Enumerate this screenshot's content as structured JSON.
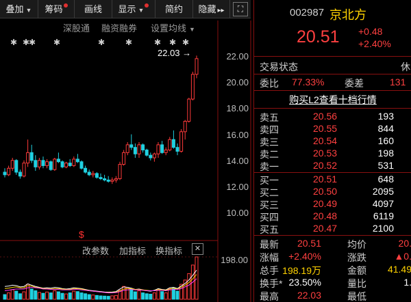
{
  "toolbar": {
    "items": [
      {
        "label": "叠加",
        "caret": true,
        "dot": false
      },
      {
        "label": "筹码",
        "caret": false,
        "dot": true
      },
      {
        "label": "画线",
        "caret": false,
        "dot": false
      },
      {
        "label": "显示",
        "caret": true,
        "dot": true
      },
      {
        "label": "简约",
        "caret": false,
        "dot": false
      },
      {
        "label": "隐藏",
        "caret": false,
        "dot": false,
        "arrow": "▸▸"
      }
    ],
    "expand_icon": "⛶"
  },
  "chart_links": {
    "shengu": "深股通",
    "rongzi": "融资融券",
    "settings": "设置均线"
  },
  "stars": [
    "✱",
    "✱✱",
    "✱",
    "✱",
    "✱",
    "✱",
    "✱",
    "✱"
  ],
  "high_marker": "22.03",
  "y_axis": [
    "22.00",
    "20.00",
    "18.00",
    "16.00",
    "14.00",
    "12.00",
    "10.00"
  ],
  "indicator": {
    "tabs": [
      "改参数",
      "加指标",
      "换指标"
    ],
    "close": "✕",
    "axis_label": "198.00"
  },
  "chart_data": {
    "type": "candlestick",
    "price_axis": {
      "ticks": [
        10,
        12,
        14,
        16,
        18,
        20,
        22
      ]
    },
    "high_annotation": 22.03,
    "volume_axis_label": 198.0,
    "candles": [
      [
        13.1,
        13.4,
        12.7,
        12.9
      ],
      [
        12.9,
        13.6,
        12.8,
        13.4
      ],
      [
        13.4,
        14.2,
        13.2,
        14.0
      ],
      [
        14.0,
        14.1,
        12.9,
        13.1
      ],
      [
        13.1,
        13.3,
        12.6,
        12.8
      ],
      [
        12.8,
        14.0,
        12.7,
        13.8
      ],
      [
        13.8,
        15.6,
        13.5,
        14.6
      ],
      [
        14.6,
        15.2,
        13.8,
        14.0
      ],
      [
        14.0,
        14.4,
        13.2,
        13.5
      ],
      [
        13.5,
        14.2,
        13.3,
        14.0
      ],
      [
        14.0,
        14.3,
        13.4,
        13.6
      ],
      [
        13.6,
        14.1,
        13.4,
        13.9
      ],
      [
        13.9,
        14.0,
        13.2,
        13.3
      ],
      [
        13.3,
        14.2,
        13.2,
        14.1
      ],
      [
        14.1,
        14.6,
        13.8,
        13.9
      ],
      [
        13.9,
        14.0,
        13.4,
        13.5
      ],
      [
        13.5,
        13.9,
        13.4,
        13.8
      ],
      [
        13.8,
        14.1,
        13.5,
        13.6
      ],
      [
        13.6,
        14.3,
        13.5,
        14.1
      ],
      [
        14.1,
        14.5,
        13.8,
        13.9
      ],
      [
        13.9,
        14.0,
        13.3,
        13.4
      ],
      [
        13.4,
        13.6,
        13.0,
        13.1
      ],
      [
        13.1,
        13.3,
        12.8,
        12.9
      ],
      [
        12.9,
        13.2,
        12.7,
        13.0
      ],
      [
        13.0,
        13.1,
        12.6,
        12.7
      ],
      [
        12.7,
        13.0,
        12.5,
        12.6
      ],
      [
        12.6,
        12.9,
        12.4,
        12.5
      ],
      [
        12.5,
        12.8,
        12.3,
        12.4
      ],
      [
        12.4,
        12.7,
        12.2,
        12.5
      ],
      [
        12.5,
        12.8,
        12.3,
        12.6
      ],
      [
        12.6,
        13.9,
        12.5,
        13.7
      ],
      [
        13.7,
        14.8,
        13.6,
        14.6
      ],
      [
        14.6,
        15.4,
        14.4,
        15.2
      ],
      [
        15.2,
        16.0,
        14.8,
        15.0
      ],
      [
        15.0,
        15.3,
        14.2,
        14.5
      ],
      [
        14.5,
        15.4,
        14.2,
        15.2
      ],
      [
        15.2,
        15.3,
        14.6,
        14.8
      ],
      [
        14.8,
        14.9,
        14.3,
        14.4
      ],
      [
        14.4,
        14.6,
        14.0,
        14.2
      ],
      [
        14.2,
        14.6,
        13.9,
        14.5
      ],
      [
        14.5,
        15.4,
        14.2,
        15.2
      ],
      [
        15.2,
        15.5,
        14.5,
        14.6
      ],
      [
        14.6,
        15.0,
        14.4,
        14.8
      ],
      [
        14.8,
        15.8,
        14.7,
        15.6
      ],
      [
        15.6,
        16.3,
        14.9,
        15.0
      ],
      [
        15.0,
        15.3,
        14.4,
        14.7
      ],
      [
        14.7,
        16.4,
        14.6,
        16.2
      ],
      [
        16.2,
        17.1,
        15.6,
        17.0
      ],
      [
        17.0,
        18.8,
        16.9,
        18.7
      ],
      [
        18.7,
        20.8,
        18.6,
        20.6
      ],
      [
        20.6,
        22.03,
        20.3,
        21.8
      ]
    ],
    "volumes": [
      22,
      30,
      45,
      38,
      26,
      35,
      70,
      48,
      40,
      32,
      28,
      34,
      30,
      40,
      35,
      28,
      25,
      30,
      38,
      36,
      30,
      26,
      22,
      20,
      18,
      16,
      15,
      14,
      16,
      18,
      42,
      60,
      55,
      48,
      35,
      40,
      30,
      26,
      24,
      30,
      44,
      36,
      30,
      50,
      52,
      38,
      70,
      90,
      120,
      160,
      198
    ],
    "ma_lines": [
      {
        "color": "#ffffff",
        "values": [
          60,
          62,
          66,
          64,
          58,
          60,
          72,
          66,
          60,
          56,
          52,
          54,
          52,
          56,
          54,
          50,
          48,
          50,
          54,
          52,
          50,
          46,
          42,
          40,
          38,
          36,
          34,
          33,
          34,
          36,
          48,
          58,
          56,
          52,
          46,
          48,
          44,
          40,
          38,
          42,
          50,
          46,
          44,
          54,
          56,
          50,
          62,
          74,
          90,
          112,
          136
        ]
      },
      {
        "color": "#ffd200",
        "values": [
          50,
          52,
          56,
          58,
          54,
          54,
          64,
          62,
          56,
          54,
          50,
          50,
          48,
          50,
          50,
          48,
          46,
          46,
          50,
          50,
          48,
          44,
          40,
          38,
          36,
          34,
          32,
          31,
          31,
          33,
          40,
          48,
          50,
          50,
          46,
          46,
          44,
          42,
          40,
          40,
          46,
          44,
          42,
          48,
          52,
          48,
          56,
          66,
          78,
          96,
          116
        ]
      },
      {
        "color": "#ff40ff",
        "values": [
          40,
          42,
          46,
          48,
          48,
          48,
          54,
          56,
          54,
          52,
          48,
          48,
          46,
          46,
          46,
          44,
          44,
          44,
          46,
          46,
          44,
          42,
          40,
          38,
          36,
          34,
          32,
          30,
          30,
          31,
          36,
          42,
          44,
          46,
          44,
          44,
          42,
          40,
          40,
          40,
          42,
          42,
          40,
          44,
          46,
          46,
          50,
          58,
          66,
          80,
          96
        ]
      }
    ]
  },
  "quote": {
    "code": "002987",
    "name": "京北方",
    "price": "20.51",
    "change": "+0.48",
    "change_pct": "+2.40%",
    "status_label": "交易状态",
    "status_value": "休",
    "weibi_label": "委比",
    "weibi_value": "77.33%",
    "weicha_label": "委差",
    "weicha_value": "131",
    "l2_link": "购买L2查看十档行情"
  },
  "asks": [
    {
      "label": "卖五",
      "price": "20.56",
      "vol": "193"
    },
    {
      "label": "卖四",
      "price": "20.55",
      "vol": "844"
    },
    {
      "label": "卖三",
      "price": "20.54",
      "vol": "160"
    },
    {
      "label": "卖二",
      "price": "20.53",
      "vol": "198"
    },
    {
      "label": "卖一",
      "price": "20.52",
      "vol": "531"
    }
  ],
  "bids": [
    {
      "label": "买一",
      "price": "20.51",
      "vol": "648"
    },
    {
      "label": "买二",
      "price": "20.50",
      "vol": "2095"
    },
    {
      "label": "买三",
      "price": "20.49",
      "vol": "4097"
    },
    {
      "label": "买四",
      "price": "20.48",
      "vol": "6119"
    },
    {
      "label": "买五",
      "price": "20.47",
      "vol": "2100"
    }
  ],
  "stats": [
    {
      "l1": "最新",
      "v1": "20.51",
      "l2": "均价",
      "v2": "20."
    },
    {
      "l1": "涨幅",
      "v1": "+2.40%",
      "l2": "涨跌",
      "v2": "▲0."
    },
    {
      "l1": "总手",
      "v1": "198.19万",
      "l2": "金额",
      "v2": "41.49"
    },
    {
      "l1": "换手*",
      "v1": "23.50%",
      "l2": "量比",
      "v2": "1."
    },
    {
      "l1": "最高",
      "v1": "22.03",
      "l2": "最低",
      "v2": ""
    }
  ]
}
